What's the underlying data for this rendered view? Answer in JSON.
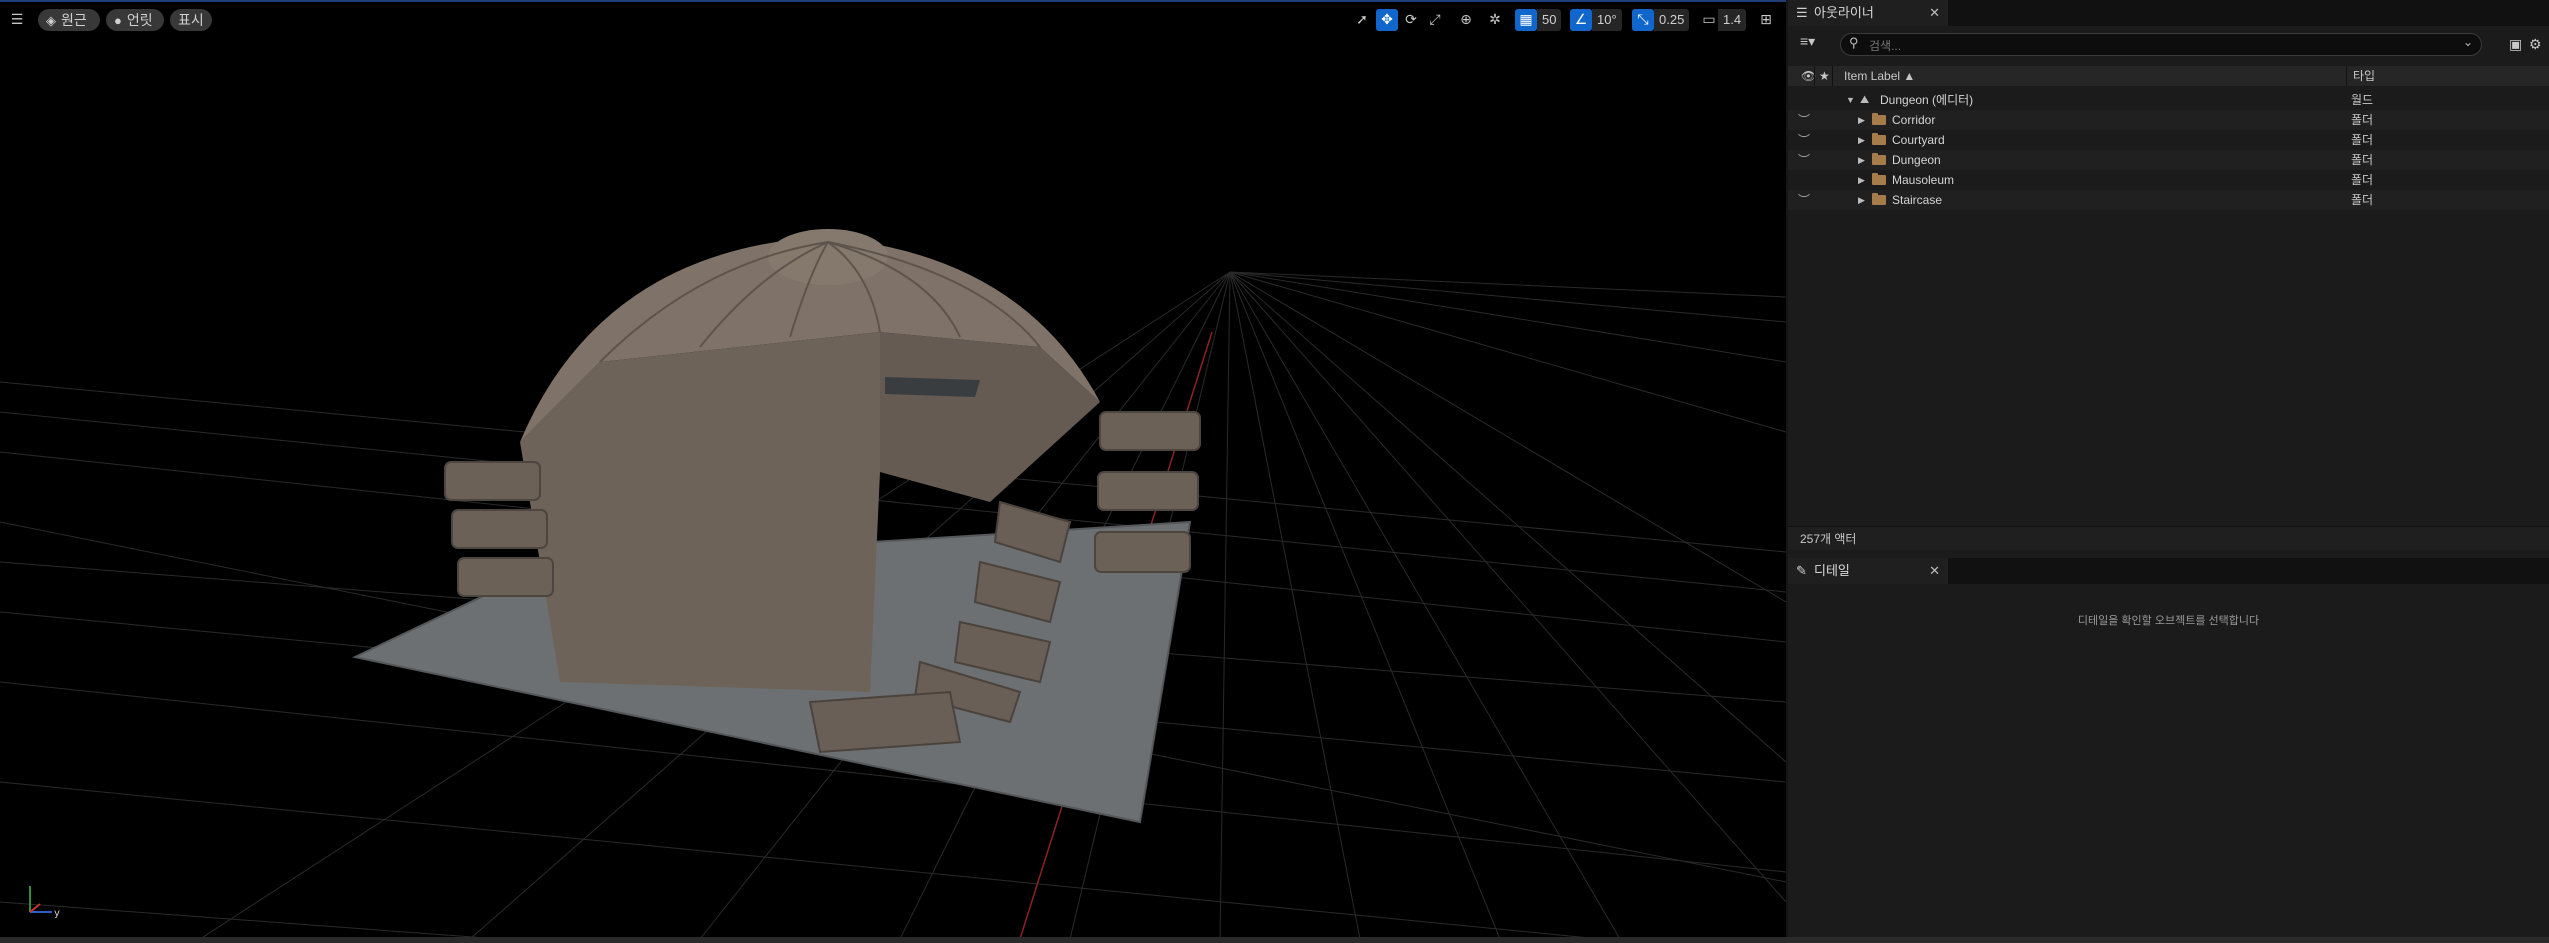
{
  "viewport": {
    "menu_icon": "hamburger-menu-icon",
    "perspective_label": "원근",
    "lit_label": "언릿",
    "show_label": "표시",
    "grid_snap_value": "50",
    "rotation_snap_value": "10°",
    "scale_snap_value": "0.25",
    "camera_speed_value": "1.4",
    "accent_color": "#1166cc"
  },
  "outliner": {
    "tab_title": "아웃라이너",
    "search_placeholder": "검색...",
    "column_item_label": "Item Label ▲",
    "column_type": "타입",
    "rows": [
      {
        "label": "Dungeon (에디터)",
        "type": "월드",
        "kind": "world",
        "indent": 0,
        "visible_toggle": false
      },
      {
        "label": "Corridor",
        "type": "폴더",
        "kind": "folder",
        "indent": 1,
        "visible_toggle": true
      },
      {
        "label": "Courtyard",
        "type": "폴더",
        "kind": "folder",
        "indent": 1,
        "visible_toggle": true
      },
      {
        "label": "Dungeon",
        "type": "폴더",
        "kind": "folder",
        "indent": 1,
        "visible_toggle": true
      },
      {
        "label": "Mausoleum",
        "type": "폴더",
        "kind": "folder",
        "indent": 1,
        "visible_toggle": false
      },
      {
        "label": "Staircase",
        "type": "폴더",
        "kind": "folder",
        "indent": 1,
        "visible_toggle": true
      }
    ],
    "actor_count": "257개 액터"
  },
  "details": {
    "tab_title": "디테일",
    "empty_message": "디테일을 확인할 오브젝트를 선택합니다"
  }
}
